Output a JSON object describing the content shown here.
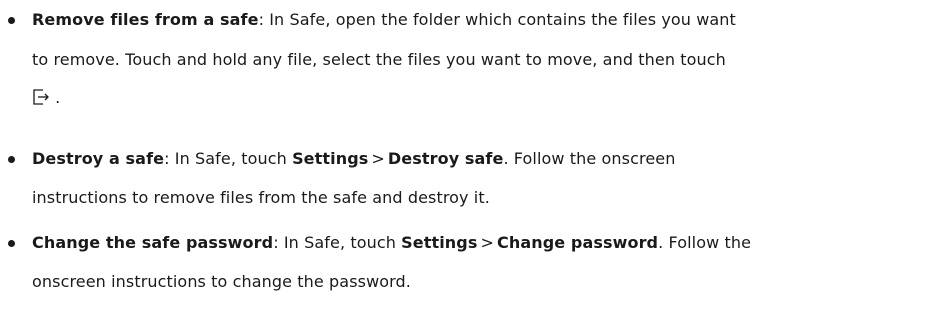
{
  "items": [
    {
      "title": "Remove files from a safe",
      "text1": ": In Safe, open the folder which contains the files you want",
      "line2": "to remove. Touch and hold any file, select the files you want to move, and then touch",
      "icon": "move-out-icon",
      "line3_tail": " ."
    },
    {
      "title": "Destroy a safe",
      "text1": ": In Safe, touch ",
      "menu1": "Settings",
      "sep": ">",
      "menu2": "Destroy safe",
      "text2": ". Follow the onscreen",
      "line2": "instructions to remove files from the safe and destroy it."
    },
    {
      "title": "Change the safe password",
      "text1": ": In Safe, touch ",
      "menu1": "Settings",
      "sep": ">",
      "menu2": "Change password",
      "text2": ". Follow the",
      "line2": "onscreen instructions to change the password."
    }
  ]
}
